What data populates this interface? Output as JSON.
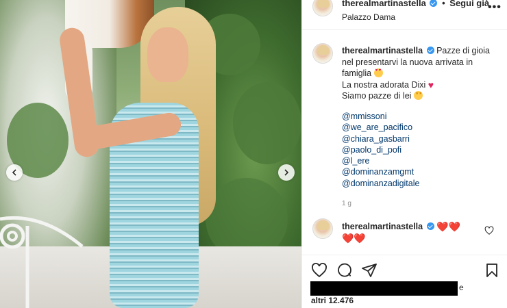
{
  "header": {
    "username": "therealmartinastella",
    "dot": "•",
    "follow_label": "Segui già",
    "location": "Palazzo Dama",
    "more": "•••"
  },
  "caption": {
    "username": "therealmartinastella",
    "text_line1": "Pazze di gioia nel presentarvi la nuova arrivata in famiglia",
    "text_line2": "La nostra adorata Dixi",
    "text_line3": "Siamo pazze di lei",
    "emoji1": "smiling-face-with-heart-eyes",
    "emoji2": "red-heart",
    "emoji3": "star-struck",
    "mentions": [
      "@mmissoni",
      "@we_are_pacifico",
      "@chiara_gasbarri",
      "@paolo_di_pofi",
      "@l_ere",
      "@dominanzamgmt",
      "@dominanzadigitale"
    ],
    "timestamp": "1 g"
  },
  "comment": {
    "username": "therealmartinastella",
    "hearts_line1": "❤️❤️",
    "hearts_line2": "❤️❤️"
  },
  "likes": {
    "redacted_text": "",
    "suffix": "e",
    "others": "altri 12.476"
  },
  "icons": {
    "like": "heart-outline-icon",
    "comment": "comment-bubble-icon",
    "share": "paper-plane-icon",
    "save": "bookmark-icon",
    "verified": "verified-badge-icon"
  },
  "colors": {
    "verified": "#3897f0",
    "mention_link": "#00376b",
    "heart": "#e0245e",
    "muted_text": "#8e8e8e"
  }
}
